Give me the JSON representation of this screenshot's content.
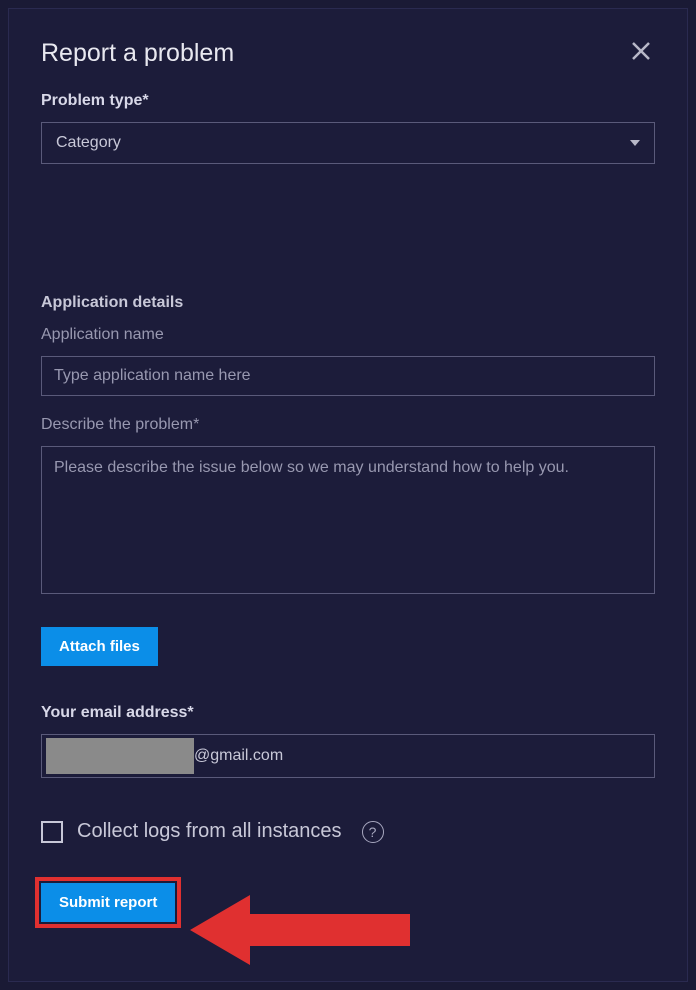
{
  "dialog": {
    "title": "Report a problem"
  },
  "form": {
    "problemType": {
      "label": "Problem type*",
      "value": "Category"
    },
    "appDetails": {
      "heading": "Application details",
      "nameLabel": "Application name",
      "namePlaceholder": "Type application name here",
      "describeLabel": "Describe the problem*",
      "describePlaceholder": "Please describe the issue below so we may understand how to help you."
    },
    "attach": {
      "button": "Attach files"
    },
    "email": {
      "label": "Your email address*",
      "domain": "@gmail.com"
    },
    "collectLogs": {
      "label": "Collect logs from all instances"
    },
    "submit": {
      "button": "Submit report"
    }
  },
  "colors": {
    "accent": "#0b8ee8",
    "highlight": "#e03030"
  }
}
